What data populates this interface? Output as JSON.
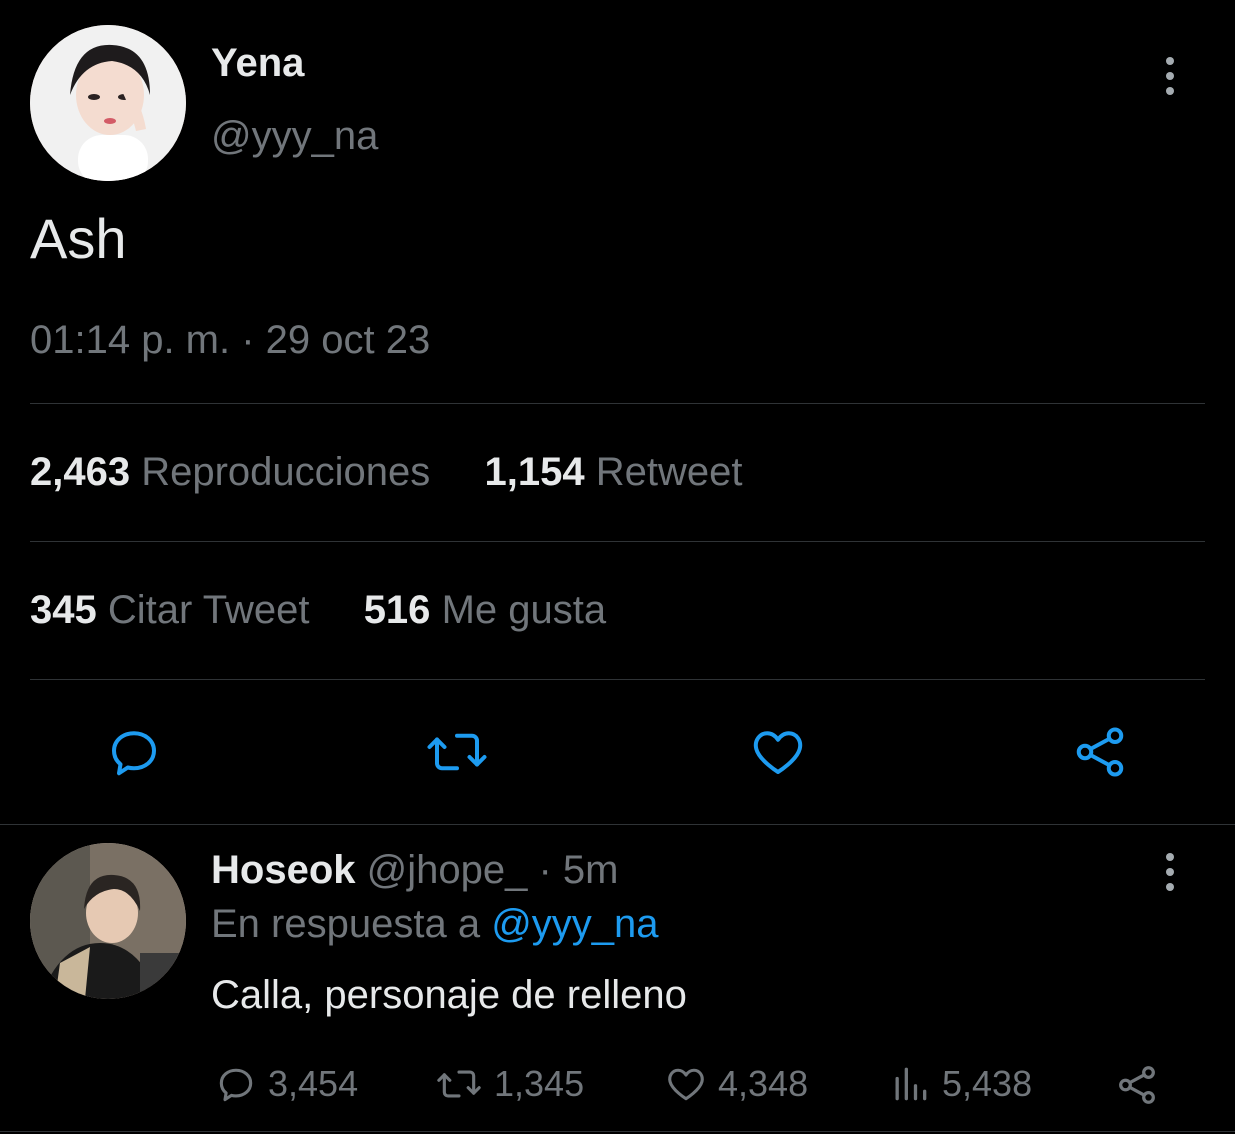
{
  "tweet": {
    "author_name": "Yena",
    "author_handle": "@yyy_na",
    "text": "Ash",
    "timestamp": "01:14 p. m. · 29 oct 23",
    "stats": {
      "views_count": "2,463",
      "views_label": "Reproducciones",
      "retweets_count": "1,154",
      "retweets_label": "Retweet",
      "quotes_count": "345",
      "quotes_label": "Citar Tweet",
      "likes_count": "516",
      "likes_label": "Me gusta"
    },
    "actions": [
      "reply-icon",
      "retweet-icon",
      "heart-icon",
      "share-icon"
    ]
  },
  "reply": {
    "author_name": "Hoseok",
    "author_handle": "@jhope_",
    "time": "· 5m",
    "replying_to_label": "En respuesta a",
    "replying_to_handle": "@yyy_na",
    "text": "Calla, personaje de relleno",
    "actions": {
      "reply_count": "3,454",
      "retweet_count": "1,345",
      "like_count": "4,348",
      "views_count": "5,438"
    }
  },
  "colors": {
    "background": "#000000",
    "text": "#e7e9ea",
    "muted": "#71767b",
    "link": "#1d9bf0",
    "divider": "#2f3336"
  }
}
